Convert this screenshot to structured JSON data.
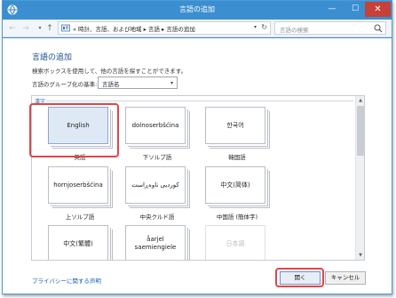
{
  "window": {
    "title": "言語の追加",
    "controls": {
      "minimize": "—",
      "maximize": "☐",
      "close": "✕"
    }
  },
  "address": {
    "back": "←",
    "forward": "→",
    "history": "▾",
    "up": "↑",
    "breadcrumb": "« 時計、言語、および地域 ▸ 言語 ▸ 言語の追加",
    "dropdown": "▾",
    "refresh": "↻",
    "search_placeholder": "言語の検索"
  },
  "main": {
    "title": "言語の追加",
    "description": "検索ボックスを使用して、他の言語を探すことができます。",
    "group_label": "言語のグループ化の基準:",
    "group_value": "言語名",
    "group_arrow": "▾",
    "section_header": "漢字",
    "languages": [
      {
        "name": "English",
        "caption": "英語",
        "state": "selected"
      },
      {
        "name": "dolnoserbšćina",
        "caption": "下ソルブ語",
        "state": "normal"
      },
      {
        "name": "한국어",
        "caption": "韓国語",
        "state": "normal"
      },
      {
        "name": "hornjoserbšćina",
        "caption": "上ソルブ語",
        "state": "normal"
      },
      {
        "name": "کوردیی ناوەڕاست",
        "caption": "中央クルド語",
        "state": "normal"
      },
      {
        "name": "中文(简体)",
        "caption": "中国語 (簡体字)",
        "state": "normal"
      },
      {
        "name": "中文(繁體)",
        "caption": "",
        "state": "normal"
      },
      {
        "name": "åarjel saemiengiele",
        "caption": "",
        "state": "normal"
      },
      {
        "name": "日本語",
        "caption": "",
        "state": "disabled"
      }
    ]
  },
  "footer": {
    "privacy_link": "プライバシーに関する声明",
    "open_label": "開く",
    "cancel_label": "キャンセル"
  },
  "colors": {
    "titlebar": "#3b8fd0",
    "close_button": "#c7403a",
    "title_text": "#1e4e8c",
    "link": "#1a5fb4",
    "highlight": "#e0454a"
  }
}
